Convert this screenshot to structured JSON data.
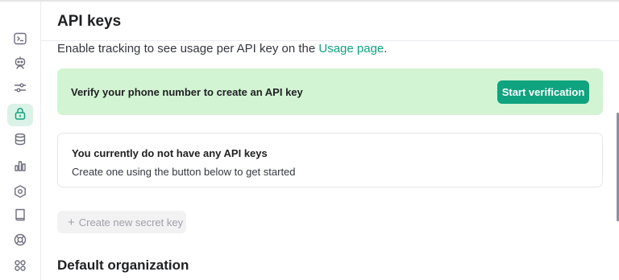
{
  "header": {
    "title": "API keys"
  },
  "description": {
    "text": "Enable tracking to see usage per API key on the ",
    "link_text": "Usage page",
    "suffix": "."
  },
  "banner": {
    "text": "Verify your phone number to create an API key",
    "button_label": "Start verification"
  },
  "empty_state": {
    "title": "You currently do not have any API keys",
    "subtitle": "Create one using the button below to get started"
  },
  "create_button": {
    "label": "Create new secret key"
  },
  "section": {
    "title": "Default organization"
  },
  "sidebar": {
    "items": [
      {
        "icon": "terminal-icon"
      },
      {
        "icon": "assistant-icon"
      },
      {
        "icon": "sliders-icon"
      },
      {
        "icon": "lock-icon",
        "active": true
      },
      {
        "icon": "database-icon"
      },
      {
        "icon": "bar-chart-icon"
      },
      {
        "icon": "gear-icon"
      },
      {
        "icon": "book-icon"
      },
      {
        "icon": "lifebuoy-icon"
      },
      {
        "icon": "apps-icon"
      }
    ]
  },
  "colors": {
    "accent": "#10a37f",
    "banner_bg": "#d2f4d3",
    "active_bg": "#dbf2e7"
  }
}
